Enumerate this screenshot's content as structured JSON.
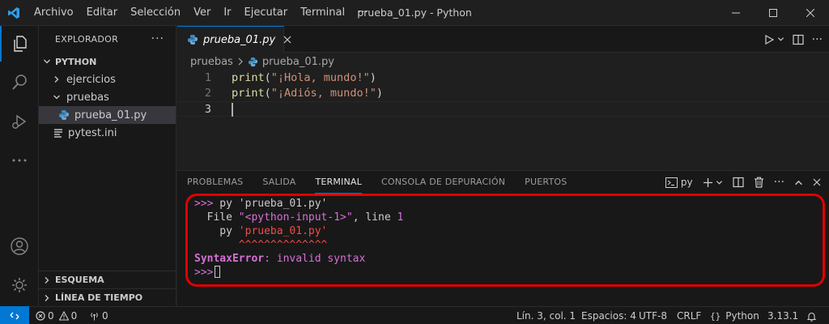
{
  "titlebar": {
    "menus": [
      "Archivo",
      "Editar",
      "Selección",
      "Ver",
      "Ir",
      "Ejecutar",
      "Terminal",
      "···"
    ],
    "title": "prueba_01.py - Python"
  },
  "sidebar": {
    "title": "EXPLORADOR",
    "root": "PYTHON",
    "items": [
      {
        "label": "ejercicios",
        "type": "folder-collapsed"
      },
      {
        "label": "pruebas",
        "type": "folder-expanded"
      },
      {
        "label": "prueba_01.py",
        "type": "python-file",
        "selected": true
      },
      {
        "label": "pytest.ini",
        "type": "ini-file"
      }
    ],
    "sections": [
      "ESQUEMA",
      "LÍNEA DE TIEMPO"
    ]
  },
  "editor": {
    "tab_label": "prueba_01.py",
    "breadcrumb": [
      "pruebas",
      "prueba_01.py"
    ],
    "lines": [
      {
        "num": "1",
        "fn": "print",
        "open": "(",
        "str": "\"¡Hola, mundo!\"",
        "close": ")"
      },
      {
        "num": "2",
        "fn": "print",
        "open": "(",
        "str": "\"¡Adiós, mundo!\"",
        "close": ")"
      },
      {
        "num": "3"
      }
    ]
  },
  "panel": {
    "tabs": [
      "PROBLEMAS",
      "SALIDA",
      "TERMINAL",
      "CONSOLA DE DEPURACIÓN",
      "PUERTOS"
    ],
    "active_tab": "TERMINAL",
    "terminal_profile": "py",
    "terminal": {
      "prompt": ">>>",
      "cmd1": " py 'prueba_01.py'",
      "file_pre": "  File ",
      "file_name": "\"<python-input-1>\"",
      "file_mid": ", line ",
      "file_line": "1",
      "code_pre": "    py ",
      "code_str": "'prueba_01.py'",
      "carets": "       ^^^^^^^^^^^^^^",
      "err_name": "SyntaxError",
      "err_msg": ": invalid syntax"
    }
  },
  "statusbar": {
    "errors": "0",
    "warnings": "0",
    "ports": "0",
    "position": "Lín. 3, col. 1",
    "spaces": "Espacios: 4",
    "encoding": "UTF-8",
    "eol": "CRLF",
    "language": "Python",
    "version": "3.13.1"
  },
  "colors": {
    "accent": "#0078d4",
    "highlight_border": "#e00000"
  }
}
